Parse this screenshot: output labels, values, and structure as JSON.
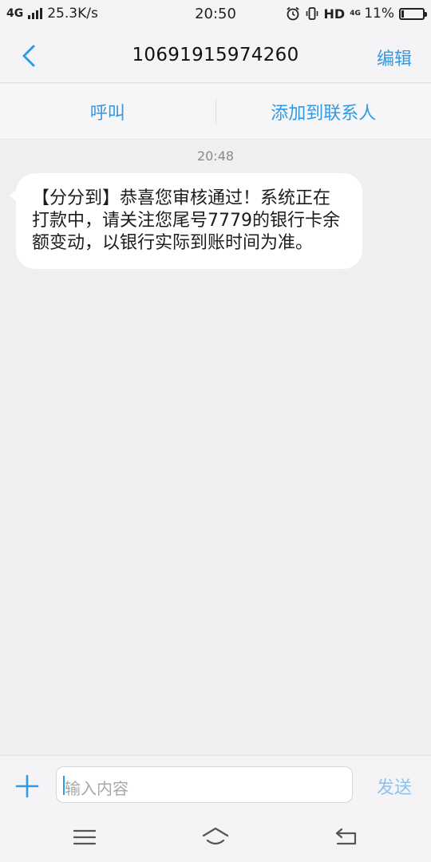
{
  "status_bar": {
    "network": "4G",
    "speed": "25.3K/s",
    "time": "20:50",
    "hd_label": "HD",
    "lte_label": "4G",
    "battery_text": "11%",
    "battery_level": 0.11
  },
  "header": {
    "back_icon": "chevron-left-icon",
    "title": "10691915974260",
    "edit_label": "编辑"
  },
  "actions": {
    "call_label": "呼叫",
    "add_contact_label": "添加到联系人"
  },
  "messages": [
    {
      "time": "20:48",
      "text": "【分分到】恭喜您审核通过！系统正在打款中，请关注您尾号7779的银行卡余额变动，以银行实际到账时间为准。"
    }
  ],
  "composer": {
    "add_icon": "plus-icon",
    "placeholder": "输入内容",
    "send_label": "发送"
  },
  "system_nav": {
    "menu_icon": "menu-icon",
    "home_icon": "home-icon",
    "back_icon": "back-arrow-icon"
  },
  "colors": {
    "accent": "#2f9ae6",
    "send_disabled": "#8ec3ee",
    "background": "#efefef",
    "bubble": "#ffffff"
  }
}
